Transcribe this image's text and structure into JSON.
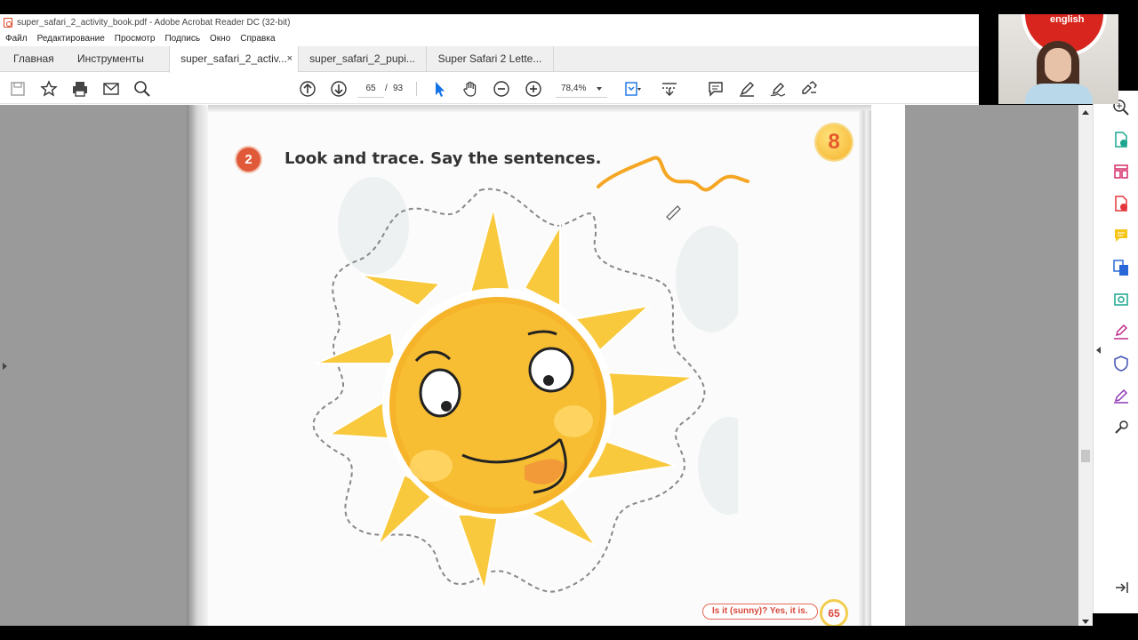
{
  "window": {
    "title": "super_safari_2_activity_book.pdf - Adobe Acrobat Reader DC (32-bit)"
  },
  "menu": [
    "Файл",
    "Редактирование",
    "Просмотр",
    "Подпись",
    "Окно",
    "Справка"
  ],
  "tabs": {
    "home": "Главная",
    "tools": "Инструменты",
    "documents": [
      {
        "label": "super_safari_2_activ...",
        "active": true,
        "close": "×"
      },
      {
        "label": "super_safari_2_pupi...",
        "active": false
      },
      {
        "label": "Super Safari 2 Lette...",
        "active": false
      }
    ]
  },
  "toolbar": {
    "page_current": "65",
    "page_separator": "/",
    "page_total": "93",
    "zoom": "78,4%"
  },
  "page_content": {
    "exercise_number": "2",
    "instruction": "Look and trace. Say the sentences.",
    "unit_number": "8",
    "footer_sentence": "Is it (sunny)? Yes, it is.",
    "footer_page": "65"
  },
  "webcam": {
    "logo_text": "english"
  },
  "colors": {
    "sun": "#f6b42a",
    "annotation": "#f5a623",
    "accent_red": "#d9473a",
    "viewer_bg": "#9a9a9a"
  },
  "icons": {
    "toolbar": [
      "save-icon",
      "star-icon",
      "print-icon",
      "email-icon",
      "search-icon",
      "prev-page-icon",
      "next-page-icon",
      "select-cursor-icon",
      "hand-icon",
      "zoom-out-icon",
      "zoom-in-icon",
      "fit-page-icon",
      "scroll-mode-icon",
      "comment-icon",
      "highlight-pen-icon",
      "sign-icon",
      "share-icon"
    ],
    "right_panel": [
      "search-doc-icon",
      "export-pdf-icon",
      "organize-pages-icon",
      "create-pdf-icon",
      "comment-icon",
      "combine-files-icon",
      "scan-icon",
      "fill-sign-icon",
      "protect-icon",
      "edit-pdf-icon",
      "more-tools-icon",
      "expand-panel-icon"
    ]
  }
}
